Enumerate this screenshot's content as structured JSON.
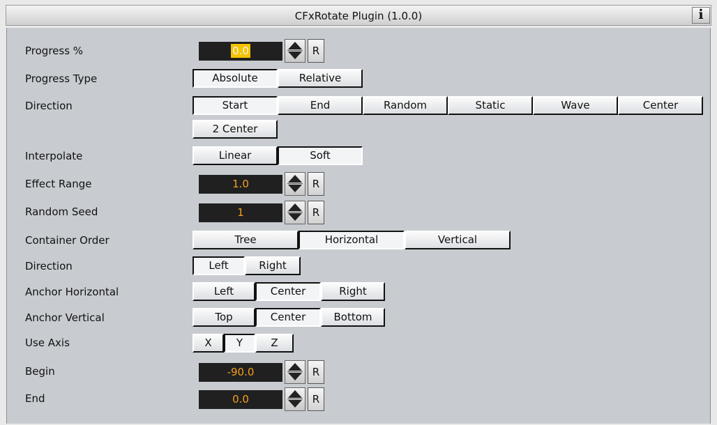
{
  "window": {
    "title": "CFxRotate Plugin (1.0.0)",
    "info_icon": "info-icon",
    "info_label": "i"
  },
  "accent_color": "#f5a01c",
  "progress": {
    "label": "Progress %",
    "value": "0.0",
    "reset_label": "R"
  },
  "progress_type": {
    "label": "Progress Type",
    "options": [
      "Absolute",
      "Relative"
    ],
    "selected": "Absolute"
  },
  "direction": {
    "label": "Direction",
    "options": [
      "Start",
      "End",
      "Random",
      "Static",
      "Wave",
      "Center",
      "2 Center"
    ],
    "selected": "Start"
  },
  "interpolate": {
    "label": "Interpolate",
    "options": [
      "Linear",
      "Soft"
    ],
    "selected": "Soft"
  },
  "effect_range": {
    "label": "Effect Range",
    "value": "1.0",
    "reset_label": "R"
  },
  "random_seed": {
    "label": "Random Seed",
    "value": "1",
    "reset_label": "R"
  },
  "container_order": {
    "label": "Container Order",
    "options": [
      "Tree",
      "Horizontal",
      "Vertical"
    ],
    "selected": "Horizontal"
  },
  "direction2": {
    "label": "Direction",
    "options": [
      "Left",
      "Right"
    ],
    "selected": "Left"
  },
  "anchor_horizontal": {
    "label": "Anchor Horizontal",
    "options": [
      "Left",
      "Center",
      "Right"
    ],
    "selected": "Center"
  },
  "anchor_vertical": {
    "label": "Anchor Vertical",
    "options": [
      "Top",
      "Center",
      "Bottom"
    ],
    "selected": "Center"
  },
  "use_axis": {
    "label": "Use Axis",
    "options": [
      "X",
      "Y",
      "Z"
    ],
    "selected": "Y"
  },
  "begin": {
    "label": "Begin",
    "value": "-90.0",
    "reset_label": "R"
  },
  "end": {
    "label": "End",
    "value": "0.0",
    "reset_label": "R"
  }
}
